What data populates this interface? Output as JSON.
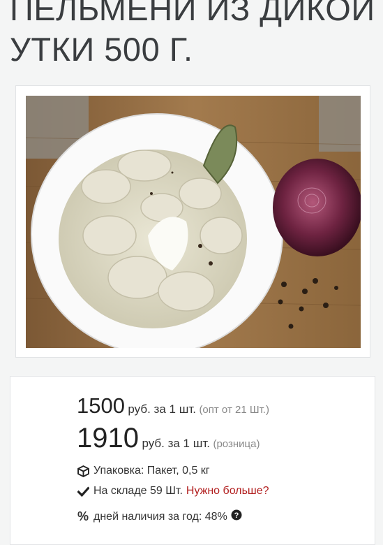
{
  "product": {
    "title_line1": "ПЕЛЬМЕНИ ИЗ ДИКОЙ",
    "title_line2": "УТКИ 500 Г."
  },
  "pricing": {
    "wholesale_price": "1500",
    "wholesale_unit": "руб. за 1 шт.",
    "wholesale_note": "(опт от 21 Шт.)",
    "retail_price": "1910",
    "retail_unit": "руб. за 1 шт.",
    "retail_note": "(розница)"
  },
  "details": {
    "package_icon": "box-icon",
    "package_text": "Упаковка: Пакет, 0,5 кг",
    "stock_icon": "checkmark-icon",
    "stock_text": "На складе 59 Шт.",
    "need_more_link": "Нужно больше?",
    "availability_icon": "percent-icon",
    "availability_text": "дней наличия за год: 48%",
    "help_icon": "question-circle-icon"
  },
  "colors": {
    "link": "#b21f1f",
    "background": "#f4f5f5"
  }
}
